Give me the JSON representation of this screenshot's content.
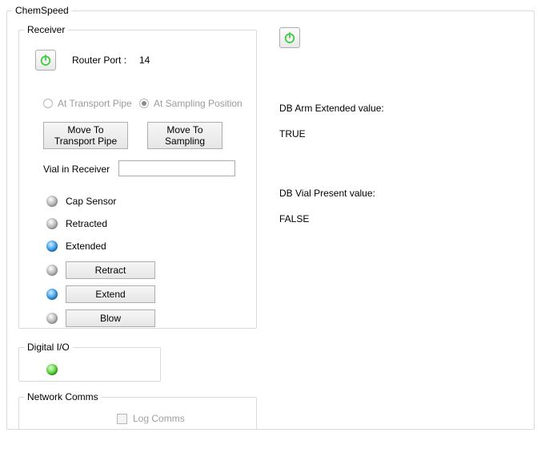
{
  "chemspeed": {
    "title": "ChemSpeed"
  },
  "receiver": {
    "title": "Receiver",
    "router_port_label": "Router Port :",
    "router_port_value": "14",
    "at_transport_pipe": "At Transport Pipe",
    "at_sampling_position": "At Sampling Position",
    "move_to_transport_pipe": "Move To\nTransport Pipe",
    "move_to_sampling": "Move To\nSampling",
    "vial_in_receiver": "Vial in Receiver",
    "cap_sensor": "Cap Sensor",
    "retracted": "Retracted",
    "extended": "Extended",
    "retract_btn": "Retract",
    "extend_btn": "Extend",
    "blow_btn": "Blow"
  },
  "digital_io": {
    "title": "Digital I/O"
  },
  "network": {
    "title": "Network Comms",
    "log_comms": "Log Comms"
  },
  "right": {
    "db_arm_label": "DB Arm Extended value:",
    "db_arm_value": "TRUE",
    "db_vial_label": "DB Vial Present value:",
    "db_vial_value": "FALSE"
  }
}
